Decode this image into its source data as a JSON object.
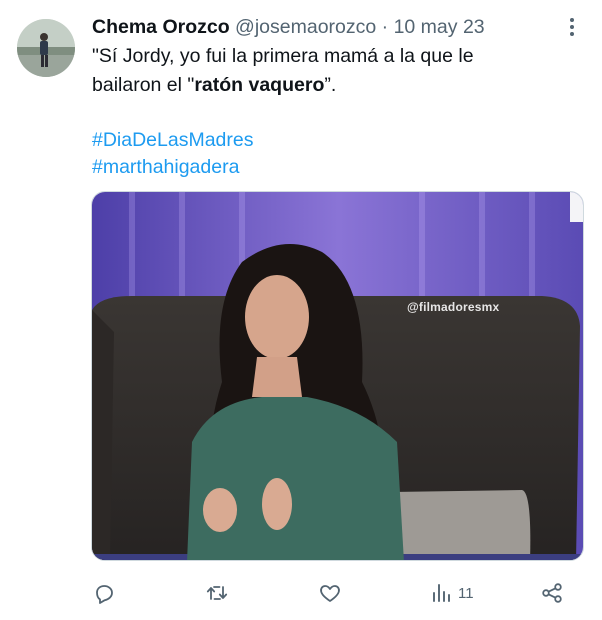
{
  "tweet": {
    "author_name": "Chema Orozco",
    "handle": "@josemaorozco",
    "separator": "·",
    "date": "10 may 23",
    "text_line1": "\"Sí Jordy, yo fui la primera mamá a la que le",
    "text_line2_prefix": "bailaron el \"",
    "text_line2_bold": "ratón vaquero",
    "text_line2_suffix": "”.",
    "hashtags": [
      "#DiaDeLasMadres",
      "#marthahigadera"
    ]
  },
  "media": {
    "watermark": "@filmadoresmx"
  },
  "actions": {
    "reply_icon": "reply-icon",
    "retweet_icon": "retweet-icon",
    "like_icon": "heart-icon",
    "views_icon": "views-chart-icon",
    "views_count": "11",
    "share_icon": "share-icon"
  },
  "colors": {
    "link": "#1d9bf0",
    "secondary_text": "#536471",
    "primary_text": "#0f1419"
  }
}
